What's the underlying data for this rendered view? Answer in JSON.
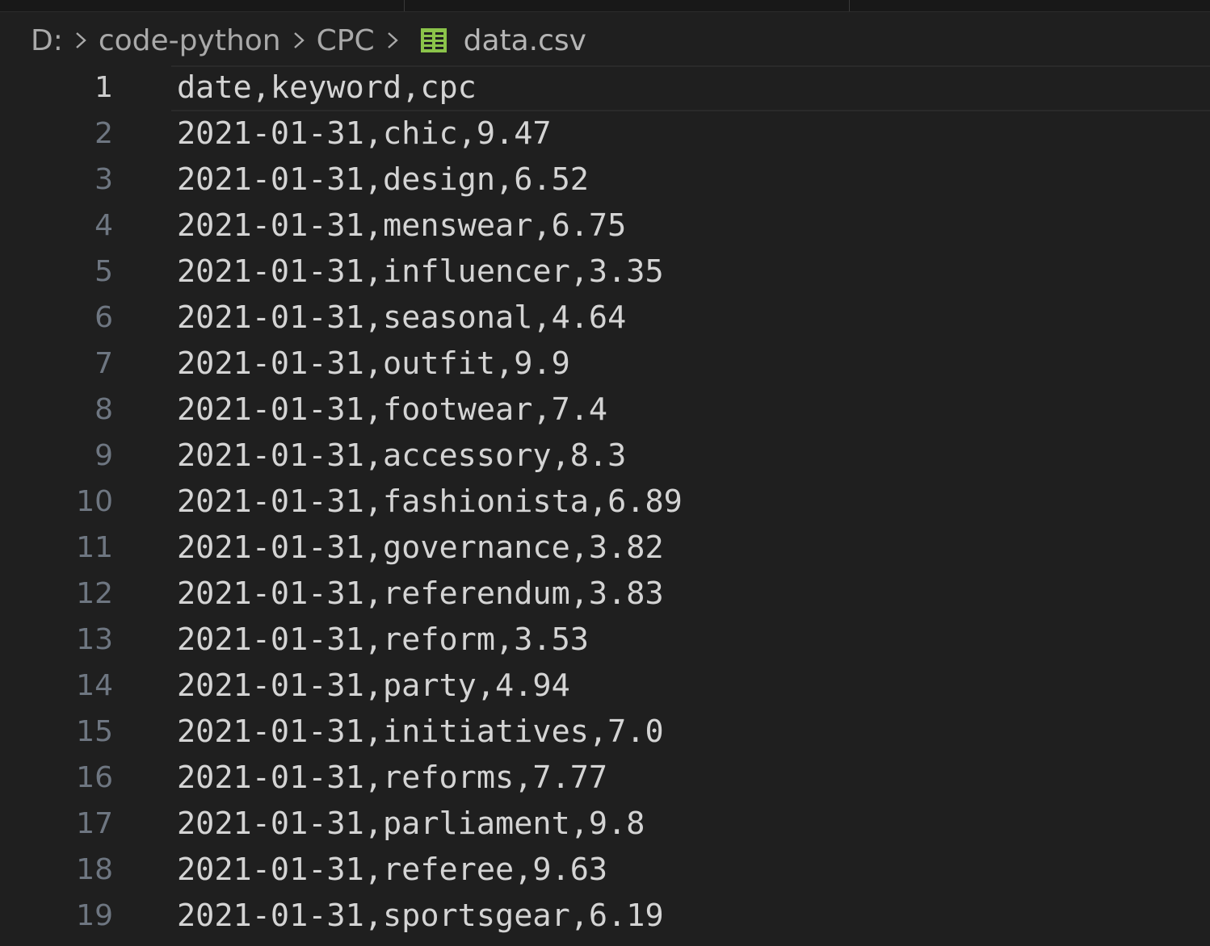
{
  "breadcrumb": {
    "drive": "D:",
    "folder1": "code-python",
    "folder2": "CPC",
    "file_icon": "csv-table-icon",
    "file": "data.csv"
  },
  "colors": {
    "background": "#1f1f1f",
    "icon_green": "#8bc34a"
  },
  "editor": {
    "active_line": 1,
    "lines": [
      {
        "n": "1",
        "text": "date,keyword,cpc"
      },
      {
        "n": "2",
        "text": "2021-01-31,chic,9.47"
      },
      {
        "n": "3",
        "text": "2021-01-31,design,6.52"
      },
      {
        "n": "4",
        "text": "2021-01-31,menswear,6.75"
      },
      {
        "n": "5",
        "text": "2021-01-31,influencer,3.35"
      },
      {
        "n": "6",
        "text": "2021-01-31,seasonal,4.64"
      },
      {
        "n": "7",
        "text": "2021-01-31,outfit,9.9"
      },
      {
        "n": "8",
        "text": "2021-01-31,footwear,7.4"
      },
      {
        "n": "9",
        "text": "2021-01-31,accessory,8.3"
      },
      {
        "n": "10",
        "text": "2021-01-31,fashionista,6.89"
      },
      {
        "n": "11",
        "text": "2021-01-31,governance,3.82"
      },
      {
        "n": "12",
        "text": "2021-01-31,referendum,3.83"
      },
      {
        "n": "13",
        "text": "2021-01-31,reform,3.53"
      },
      {
        "n": "14",
        "text": "2021-01-31,party,4.94"
      },
      {
        "n": "15",
        "text": "2021-01-31,initiatives,7.0"
      },
      {
        "n": "16",
        "text": "2021-01-31,reforms,7.77"
      },
      {
        "n": "17",
        "text": "2021-01-31,parliament,9.8"
      },
      {
        "n": "18",
        "text": "2021-01-31,referee,9.63"
      },
      {
        "n": "19",
        "text": "2021-01-31,sportsgear,6.19"
      }
    ]
  }
}
